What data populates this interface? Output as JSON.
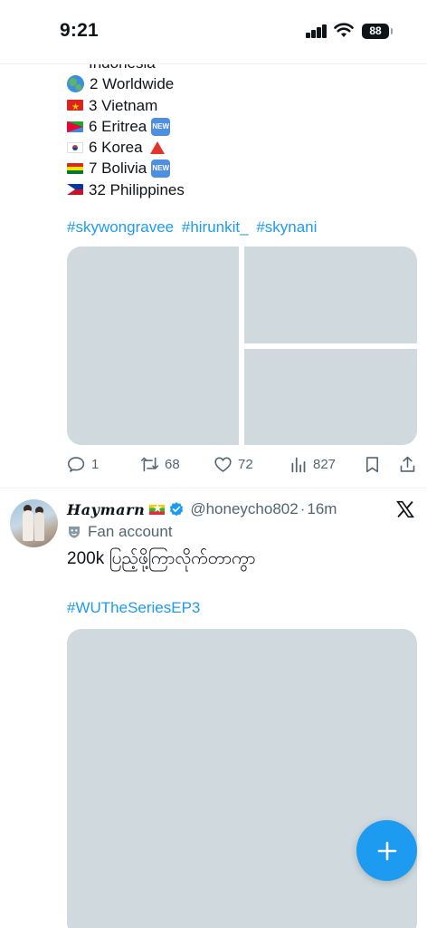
{
  "status_bar": {
    "time": "9:21",
    "battery": "88"
  },
  "tweet1": {
    "list": [
      {
        "icon": "indonesia-flag",
        "text": "Indonesia"
      },
      {
        "icon": "globe-icon",
        "text": "2 Worldwide"
      },
      {
        "icon": "vietnam-flag",
        "text": "3 Vietnam"
      },
      {
        "icon": "eritrea-flag",
        "text": "6 Eritrea",
        "badge": "NEW"
      },
      {
        "icon": "korea-flag",
        "text": "6 Korea",
        "trend": "up"
      },
      {
        "icon": "bolivia-flag",
        "text": "7 Bolivia",
        "badge": "NEW"
      },
      {
        "icon": "philippines-flag",
        "text": "32 Philippines"
      }
    ],
    "hashtags": [
      "#skywongravee",
      "#hirunkit_",
      "#skynani"
    ],
    "actions": {
      "replies": "1",
      "reposts": "68",
      "likes": "72",
      "views": "827"
    }
  },
  "tweet2": {
    "display_name": "Haymarn",
    "handle": "@honeycho802",
    "separator": "·",
    "time": "16m",
    "account_label": "Fan account",
    "text": "200k ပြည့်ဖို့ကြာလိုက်တာကွာ",
    "hashtag": "#WUTheSeriesEP3"
  },
  "colors": {
    "accent": "#1d9bf0",
    "secondary_text": "#536471",
    "media_placeholder": "#cfd9de"
  }
}
